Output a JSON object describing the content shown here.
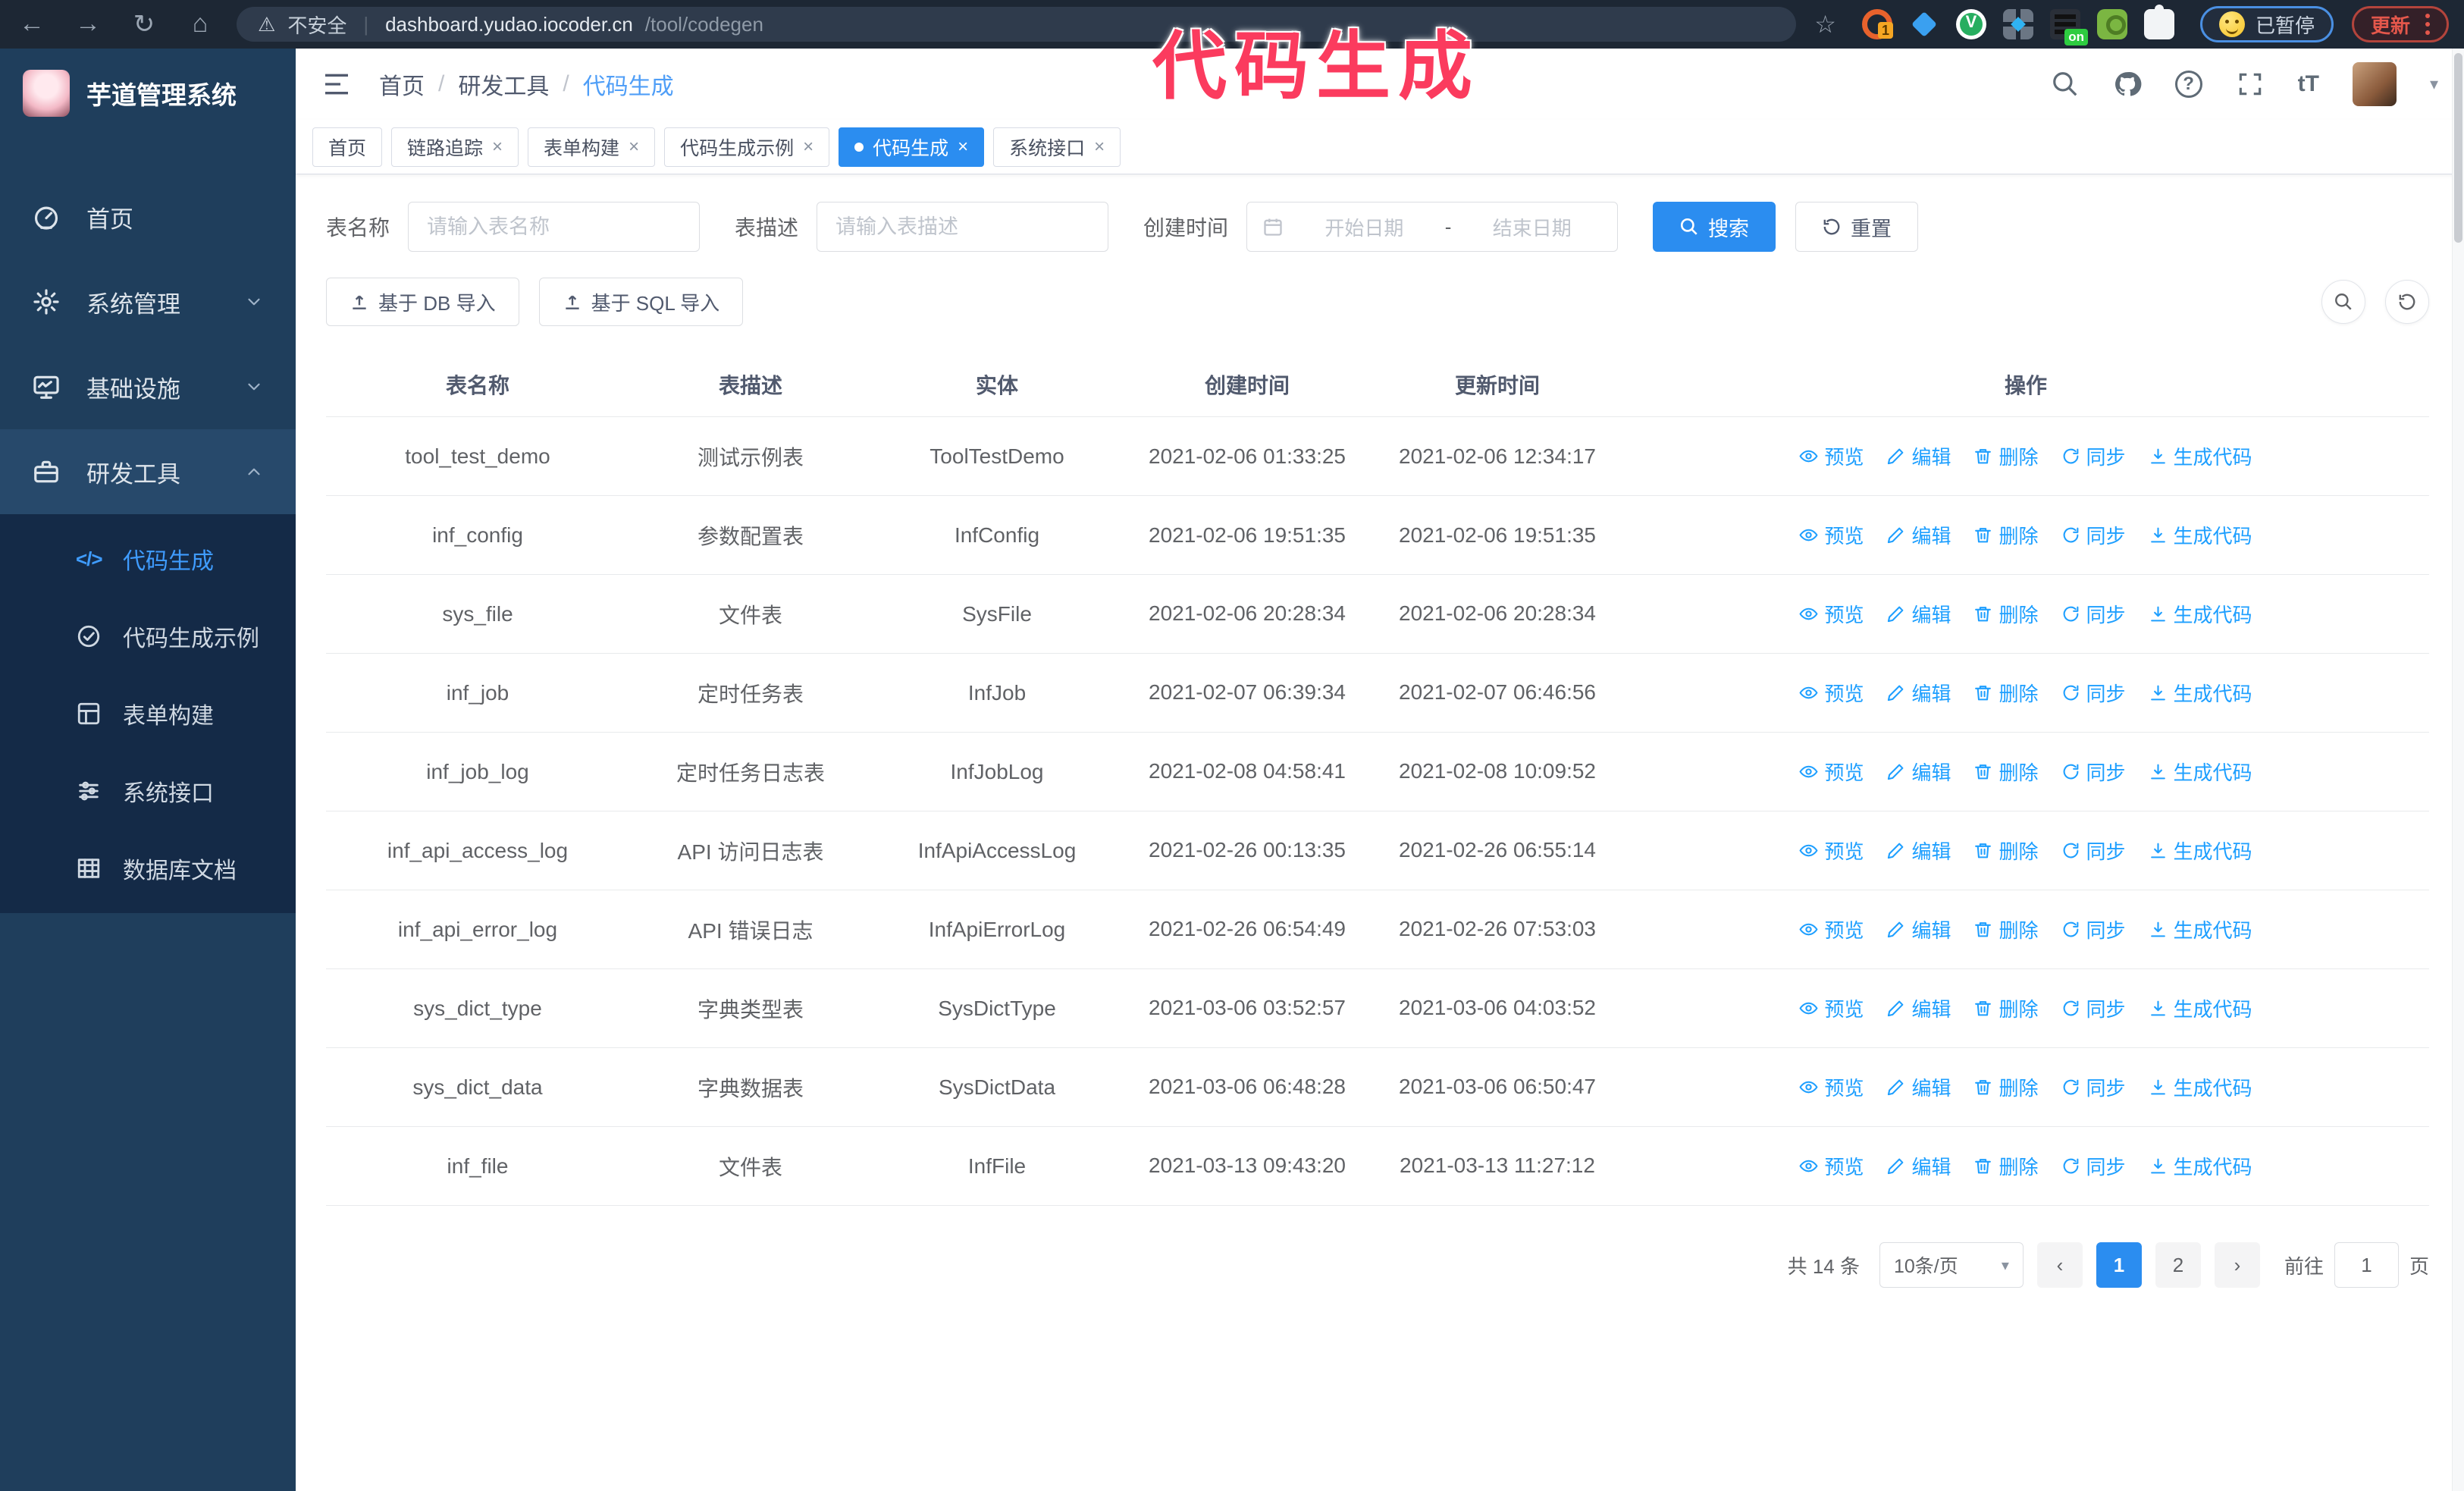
{
  "browser": {
    "security_label": "不安全",
    "url_host": "dashboard.yudao.iocoder.cn",
    "url_path": "/tool/codegen",
    "extensions": [
      {
        "style": "orange",
        "badge": "1"
      },
      {
        "style": "blue",
        "badge": ""
      },
      {
        "style": "green-circle",
        "badge": ""
      },
      {
        "style": "grid",
        "badge": ""
      },
      {
        "style": "dark",
        "badge": "on"
      },
      {
        "style": "greenkey",
        "badge": ""
      },
      {
        "style": "puzzle",
        "badge": ""
      }
    ],
    "paused_label": "已暂停",
    "update_label": "更新"
  },
  "annotation": {
    "text": "代码生成"
  },
  "sidebar": {
    "app_title": "芋道管理系统",
    "items": [
      {
        "label": "首页",
        "icon": "dashboard",
        "chevron": "",
        "open": false
      },
      {
        "label": "系统管理",
        "icon": "gear",
        "chevron": "down",
        "open": false
      },
      {
        "label": "基础设施",
        "icon": "monitor",
        "chevron": "down",
        "open": false
      },
      {
        "label": "研发工具",
        "icon": "tool",
        "chevron": "up",
        "open": true
      }
    ],
    "subitems": [
      {
        "label": "代码生成",
        "icon": "code",
        "active": true
      },
      {
        "label": "代码生成示例",
        "icon": "example",
        "active": false
      },
      {
        "label": "表单构建",
        "icon": "form",
        "active": false
      },
      {
        "label": "系统接口",
        "icon": "api",
        "active": false
      },
      {
        "label": "数据库文档",
        "icon": "db",
        "active": false
      }
    ]
  },
  "navbar": {
    "breadcrumb": [
      "首页",
      "研发工具",
      "代码生成"
    ],
    "text_size_label": "tT",
    "question_label": "?"
  },
  "tags": [
    {
      "label": "首页",
      "closable": false,
      "active": false
    },
    {
      "label": "链路追踪",
      "closable": true,
      "active": false
    },
    {
      "label": "表单构建",
      "closable": true,
      "active": false
    },
    {
      "label": "代码生成示例",
      "closable": true,
      "active": false
    },
    {
      "label": "代码生成",
      "closable": true,
      "active": true
    },
    {
      "label": "系统接口",
      "closable": true,
      "active": false
    }
  ],
  "search_form": {
    "table_name_label": "表名称",
    "table_name_placeholder": "请输入表名称",
    "table_desc_label": "表描述",
    "table_desc_placeholder": "请输入表描述",
    "create_time_label": "创建时间",
    "date_start_placeholder": "开始日期",
    "date_separator": "-",
    "date_end_placeholder": "结束日期",
    "search_label": "搜索",
    "reset_label": "重置"
  },
  "toolbar": {
    "import_db_label": "基于 DB 导入",
    "import_sql_label": "基于 SQL 导入"
  },
  "table": {
    "columns": [
      "表名称",
      "表描述",
      "实体",
      "创建时间",
      "更新时间",
      "操作"
    ],
    "actions": [
      {
        "label": "预览",
        "icon": "eye"
      },
      {
        "label": "编辑",
        "icon": "edit"
      },
      {
        "label": "删除",
        "icon": "trash"
      },
      {
        "label": "同步",
        "icon": "sync"
      },
      {
        "label": "生成代码",
        "icon": "download"
      }
    ],
    "rows": [
      {
        "name": "tool_test_demo",
        "desc": "测试示例表",
        "entity": "ToolTestDemo",
        "created": "2021-02-06 01:33:25",
        "updated": "2021-02-06 12:34:17"
      },
      {
        "name": "inf_config",
        "desc": "参数配置表",
        "entity": "InfConfig",
        "created": "2021-02-06 19:51:35",
        "updated": "2021-02-06 19:51:35"
      },
      {
        "name": "sys_file",
        "desc": "文件表",
        "entity": "SysFile",
        "created": "2021-02-06 20:28:34",
        "updated": "2021-02-06 20:28:34"
      },
      {
        "name": "inf_job",
        "desc": "定时任务表",
        "entity": "InfJob",
        "created": "2021-02-07 06:39:34",
        "updated": "2021-02-07 06:46:56"
      },
      {
        "name": "inf_job_log",
        "desc": "定时任务日志表",
        "entity": "InfJobLog",
        "created": "2021-02-08 04:58:41",
        "updated": "2021-02-08 10:09:52"
      },
      {
        "name": "inf_api_access_log",
        "desc": "API 访问日志表",
        "entity": "InfApiAccessLog",
        "created": "2021-02-26 00:13:35",
        "updated": "2021-02-26 06:55:14"
      },
      {
        "name": "inf_api_error_log",
        "desc": "API 错误日志",
        "entity": "InfApiErrorLog",
        "created": "2021-02-26 06:54:49",
        "updated": "2021-02-26 07:53:03"
      },
      {
        "name": "sys_dict_type",
        "desc": "字典类型表",
        "entity": "SysDictType",
        "created": "2021-03-06 03:52:57",
        "updated": "2021-03-06 04:03:52"
      },
      {
        "name": "sys_dict_data",
        "desc": "字典数据表",
        "entity": "SysDictData",
        "created": "2021-03-06 06:48:28",
        "updated": "2021-03-06 06:50:47"
      },
      {
        "name": "inf_file",
        "desc": "文件表",
        "entity": "InfFile",
        "created": "2021-03-13 09:43:20",
        "updated": "2021-03-13 11:27:12"
      }
    ]
  },
  "pagination": {
    "total_label": "共 14 条",
    "page_size_label": "10条/页",
    "pages": [
      "1",
      "2"
    ],
    "active_page": "1",
    "goto_label": "前往",
    "goto_value": "1",
    "page_suffix_label": "页"
  },
  "colors": {
    "primary": "#2b8df0",
    "link": "#1e9fff",
    "annotation": "#fb3b5e",
    "sidebar_bg": "#1f3e5c",
    "submenu_bg": "#142a47"
  }
}
